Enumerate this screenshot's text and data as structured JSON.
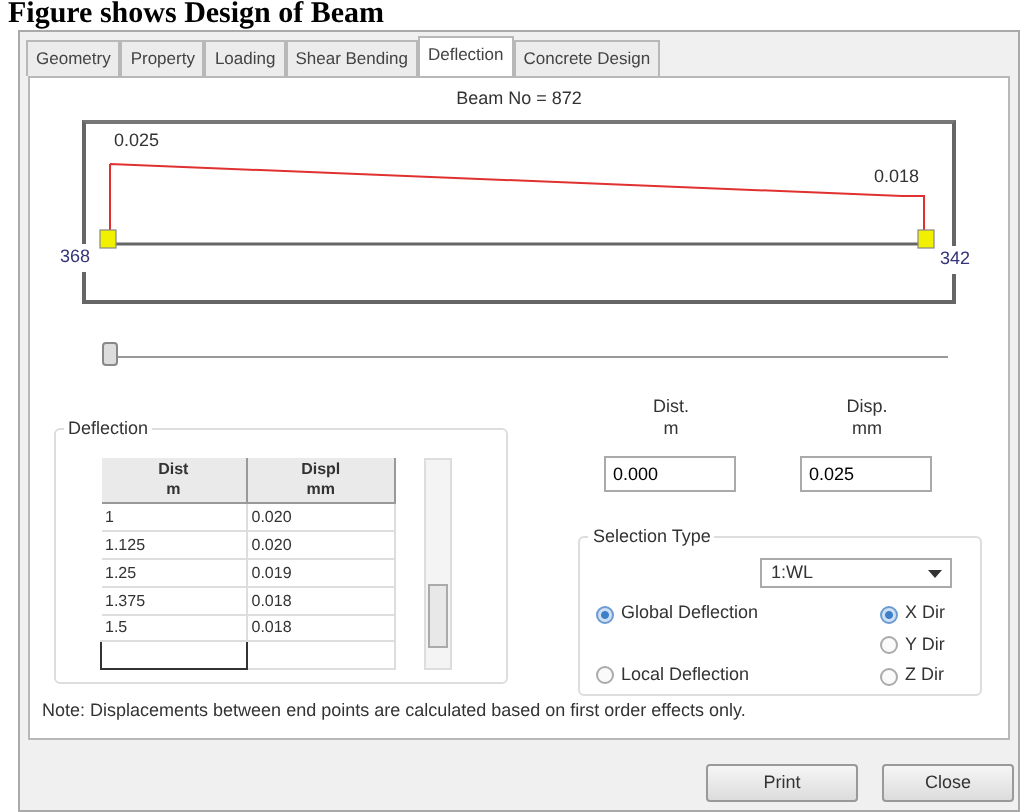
{
  "caption": "Figure shows Design of Beam",
  "tabs": [
    {
      "label": "Geometry",
      "selected": false
    },
    {
      "label": "Property",
      "selected": false
    },
    {
      "label": "Loading",
      "selected": false
    },
    {
      "label": "Shear Bending",
      "selected": false
    },
    {
      "label": "Deflection",
      "selected": true
    },
    {
      "label": "Concrete Design",
      "selected": false
    }
  ],
  "beam_label": "Beam No = 872",
  "diagram": {
    "start_value": "0.025",
    "end_value": "0.018",
    "start_node": "368",
    "end_node": "342"
  },
  "slider": {
    "level": 0
  },
  "deflection_group": {
    "title": "Deflection",
    "columns": [
      {
        "line1": "Dist",
        "line2": "m"
      },
      {
        "line1": "Displ",
        "line2": "mm"
      }
    ],
    "rows": [
      [
        "1",
        "0.020"
      ],
      [
        "1.125",
        "0.020"
      ],
      [
        "1.25",
        "0.019"
      ],
      [
        "1.375",
        "0.018"
      ],
      [
        "1.5",
        "0.018"
      ]
    ]
  },
  "readouts": [
    {
      "line1": "Dist.",
      "line2": "m",
      "value": "0.000"
    },
    {
      "line1": "Disp.",
      "line2": "mm",
      "value": "0.025"
    }
  ],
  "selection_type": {
    "title": "Selection Type",
    "dropdown": "1:WL",
    "modes": [
      {
        "label": "Global Deflection",
        "selected": true
      },
      {
        "label": "Local Deflection",
        "selected": false
      }
    ],
    "directions": [
      {
        "label": "X Dir",
        "selected": true
      },
      {
        "label": "Y Dir",
        "selected": false
      },
      {
        "label": "Z Dir",
        "selected": false
      }
    ]
  },
  "note": "Note: Displacements between end points are calculated based on first order effects only.",
  "buttons": [
    "Print",
    "Close"
  ]
}
